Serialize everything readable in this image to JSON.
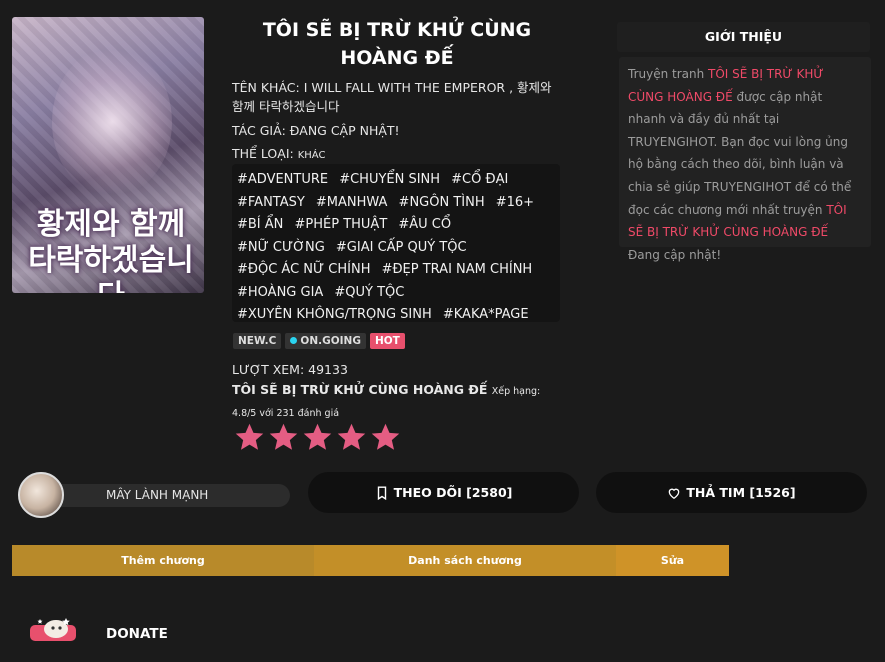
{
  "cover": {
    "title_text": "황제와 함께 타락하겠습니다"
  },
  "title": "TÔI SẼ BỊ TRỪ KHỬ CÙNG HOÀNG ĐẾ",
  "other_name": "TÊN KHÁC: I WILL FALL WITH THE EMPEROR , 황제와 함께 타락하겠습니다",
  "author": "TÁC GIẢ: ĐANG CẬP NHẬT!",
  "genre_label": "THỂ LOẠI:",
  "genre_extra": "KHÁC",
  "tags": [
    "#ADVENTURE",
    "#CHUYỂN SINH",
    "#CỔ ĐẠI",
    "#FANTASY",
    "#MANHWA",
    "#NGÔN TÌNH",
    "#16+",
    "#BÍ ẨN",
    "#PHÉP THUẬT",
    "#ÂU CỔ",
    "#NỮ CƯỜNG",
    "#GIAI CẤP QUÝ TỘC",
    "#ĐỘC ÁC NỮ CHÍNH",
    "#ĐẸP TRAI NAM CHÍNH",
    "#HOÀNG GIA",
    "#QUÝ TỘC",
    "#XUYÊN KHÔNG/TRỌNG SINH",
    "#KAKA*PAGE"
  ],
  "badges": {
    "new": "NEW.C",
    "status": "ON.GOING",
    "hot": "HOT"
  },
  "views": "LƯỢT XEM: 49133",
  "rating": {
    "title": "TÔI SẼ BỊ TRỪ KHỬ CÙNG HOÀNG ĐẾ",
    "text": "Xếp hạng: 4.8/5 với 231 đánh giá",
    "value": 4.8,
    "max": 5
  },
  "intro": {
    "heading": "GIỚI THIỆU",
    "p1": "Truyện tranh ",
    "p1_hl": "TÔI SẼ BỊ TRỪ KHỬ CÙNG HOÀNG ĐẾ",
    "p2": " được cập nhật nhanh và đầy đủ nhất tại TRUYENGIHOT. Bạn đọc vui lòng ủng hộ bằng cách theo dõi, bình luận và chia sẻ giúp TRUYENGIHOT để có thể đọc các chương mới nhất truyện ",
    "p2_hl": "TÔI SẼ BỊ TRỪ KHỬ CÙNG HOÀNG ĐẾ",
    "status": "Đang cập nhật!"
  },
  "user": {
    "name": "MÂY LÀNH MẠNH"
  },
  "follow": "THEO DÕI [2580]",
  "like": "THẢ TIM [1526]",
  "actions": [
    {
      "label": "Thêm chương",
      "color": "#b88a2a"
    },
    {
      "label": "Danh sách chương",
      "color": "#c38f28"
    },
    {
      "label": "Sửa",
      "color": "#cf9328"
    }
  ],
  "donate": "DONATE",
  "colors": {
    "accent": "#e8506d",
    "highlight": "#f04a68",
    "star": "#e45d83"
  }
}
